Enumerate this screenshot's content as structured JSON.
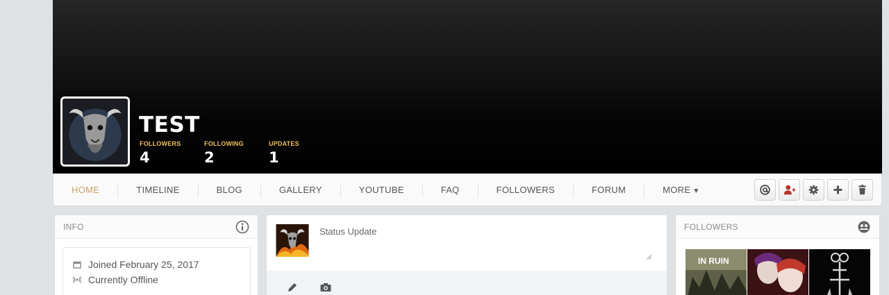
{
  "profile": {
    "name": "TEST",
    "stats": [
      {
        "label": "FOLLOWERS",
        "value": "4"
      },
      {
        "label": "FOLLOWING",
        "value": "2"
      },
      {
        "label": "UPDATES",
        "value": "1"
      }
    ]
  },
  "nav": {
    "items": [
      "HOME",
      "TIMELINE",
      "BLOG",
      "GALLERY",
      "YOUTUBE",
      "FAQ",
      "FOLLOWERS",
      "FORUM",
      "MORE"
    ],
    "active": "HOME",
    "actions": [
      "mention-icon",
      "add-friend-icon",
      "gear-icon",
      "plus-icon",
      "trash-icon"
    ]
  },
  "info": {
    "title": "INFO",
    "joined": "Joined February 25, 2017",
    "status": "Currently Offline"
  },
  "status_update": {
    "placeholder": "Status Update",
    "tools": [
      "pencil-icon",
      "camera-icon"
    ]
  },
  "followers": {
    "title": "FOLLOWERS",
    "thumb_caption": "IN RUIN"
  },
  "colors": {
    "accent": "#c8a26a",
    "stat_label": "#f0c060",
    "add_friend": "#b8332a"
  }
}
